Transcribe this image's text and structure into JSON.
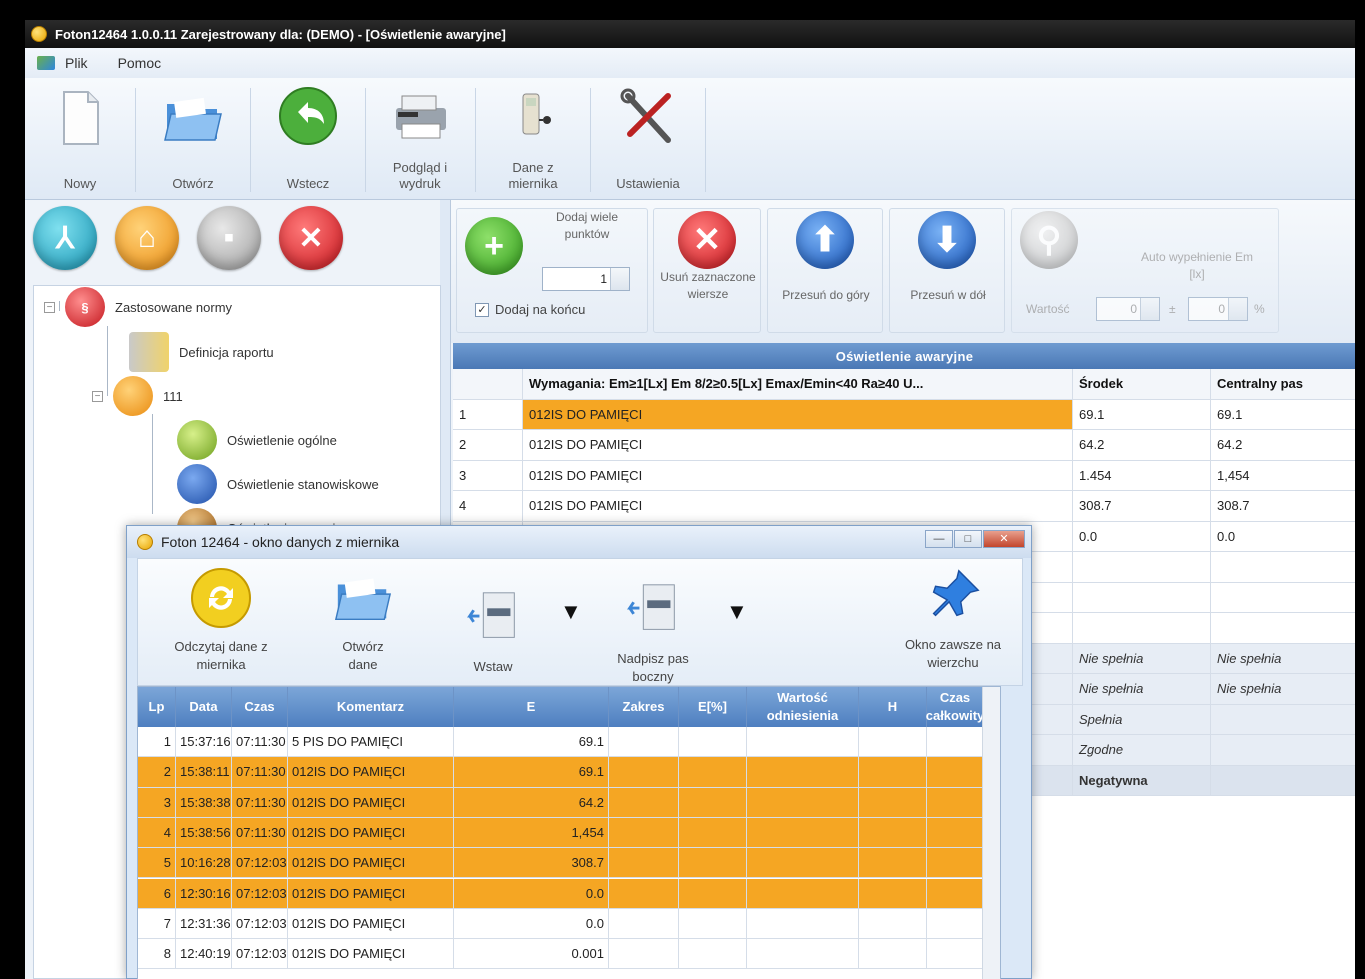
{
  "window": {
    "title": "Foton12464 1.0.0.11 Zarejestrowany dla: (DEMO) - [Oświetlenie awaryjne]"
  },
  "menu": {
    "items": [
      "Plik",
      "Pomoc"
    ]
  },
  "ribbon": {
    "buttons": [
      {
        "label": "Nowy",
        "icon": "new-document-icon"
      },
      {
        "label": "Otwórz",
        "icon": "open-folder-icon"
      },
      {
        "label": "Wstecz",
        "icon": "back-arrow-icon"
      },
      {
        "label": "Podgląd i wydruk",
        "icon": "printer-icon"
      },
      {
        "label": "Dane z miernika",
        "icon": "meter-icon"
      },
      {
        "label": "Ustawienia",
        "icon": "tools-icon"
      }
    ]
  },
  "nav": {
    "icons": [
      "tree-icon",
      "home-icon",
      "disk-icon",
      "close-icon"
    ]
  },
  "tree": {
    "root": "Zastosowane normy",
    "report": "Definicja raportu",
    "node": "111",
    "children": [
      "Oświetlenie ogólne",
      "Oświetlenie stanowiskowe",
      "Oświetlenie awaryjne"
    ]
  },
  "toolbar": {
    "add_many_label": "Dodaj wiele punktów",
    "count_value": "1",
    "append_label": "Dodaj na końcu",
    "append_checked": "✓",
    "delete_label": "Usuń zaznaczone wiersze",
    "move_up_label": "Przesuń do góry",
    "move_down_label": "Przesuń w dół",
    "autofill_label": "Auto wypełnienie Em [lx]",
    "value_label": "Wartość",
    "value_from": "0",
    "value_sep": "±",
    "value_to": "0",
    "percent": "%"
  },
  "main_grid": {
    "title": "Oświetlenie awaryjne",
    "headers": [
      "",
      "Wymagania: Em≥1[Lx]  Em 8/2≥0.5[Lx]  Emax/Emin<40  Ra≥40  U...",
      "Środek",
      "Centralny pas"
    ],
    "rows": [
      {
        "n": "1",
        "desc": "012IS DO PAMIĘCI",
        "a": "69.1",
        "b": "69.1"
      },
      {
        "n": "2",
        "desc": "012IS DO PAMIĘCI",
        "a": "64.2",
        "b": "64.2"
      },
      {
        "n": "3",
        "desc": "012IS DO PAMIĘCI",
        "a": "1.454",
        "b": "1,454"
      },
      {
        "n": "4",
        "desc": "012IS DO PAMIĘCI",
        "a": "308.7",
        "b": "308.7"
      },
      {
        "n": "",
        "desc": "",
        "a": "0.0",
        "b": "0.0"
      }
    ],
    "status": [
      {
        "a": "Nie spełnia",
        "b": "Nie spełnia"
      },
      {
        "a": "Nie spełnia",
        "b": "Nie spełnia"
      },
      {
        "a": "Spełnia",
        "b": ""
      },
      {
        "a": "Zgodne",
        "b": ""
      },
      {
        "a": "Negatywna",
        "b": ""
      }
    ]
  },
  "dialog": {
    "title": "Foton 12464 - okno danych z miernika",
    "window_buttons": [
      "—",
      "□",
      "✕"
    ],
    "buttons": [
      {
        "label": "Odczytaj dane z miernika",
        "icon": "read-meter-icon"
      },
      {
        "label": "Otwórz dane",
        "icon": "open-folder-icon"
      },
      {
        "label": "Wstaw",
        "icon": "insert-icon"
      },
      {
        "label": "Nadpisz pas boczny",
        "icon": "overwrite-icon"
      },
      {
        "label": "Okno zawsze na wierzchu",
        "icon": "pin-icon"
      }
    ],
    "dropdown_glyph": "▼",
    "headers": [
      "Lp",
      "Data",
      "Czas",
      "Komentarz",
      "E",
      "Zakres",
      "E[%]",
      "Wartość odniesienia",
      "H",
      "Czas całkowity"
    ],
    "rows": [
      {
        "lp": "1",
        "data": "15:37:16",
        "czas": "07:11:30",
        "kom": "5 PIS DO PAMIĘCI",
        "e": "69.1",
        "hl": false
      },
      {
        "lp": "2",
        "data": "15:38:11",
        "czas": "07:11:30",
        "kom": "012IS DO PAMIĘCI",
        "e": "69.1",
        "hl": true
      },
      {
        "lp": "3",
        "data": "15:38:38",
        "czas": "07:11:30",
        "kom": "012IS DO PAMIĘCI",
        "e": "64.2",
        "hl": true
      },
      {
        "lp": "4",
        "data": "15:38:56",
        "czas": "07:11:30",
        "kom": "012IS DO PAMIĘCI",
        "e": "1,454",
        "hl": true
      },
      {
        "lp": "5",
        "data": "10:16:28",
        "czas": "07:12:03",
        "kom": "012IS DO PAMIĘCI",
        "e": "308.7",
        "hl": true
      },
      {
        "lp": "6",
        "data": "12:30:16",
        "czas": "07:12:03",
        "kom": "012IS DO PAMIĘCI",
        "e": "0.0",
        "hl": true
      },
      {
        "lp": "7",
        "data": "12:31:36",
        "czas": "07:12:03",
        "kom": "012IS DO PAMIĘCI",
        "e": "0.0",
        "hl": false
      },
      {
        "lp": "8",
        "data": "12:40:19",
        "czas": "07:12:03",
        "kom": "012IS DO PAMIĘCI",
        "e": "0.001",
        "hl": false
      }
    ]
  },
  "colors": {
    "highlight": "#f5a623",
    "header_blue": "#4e7fc0",
    "title_dark": "#111111"
  }
}
